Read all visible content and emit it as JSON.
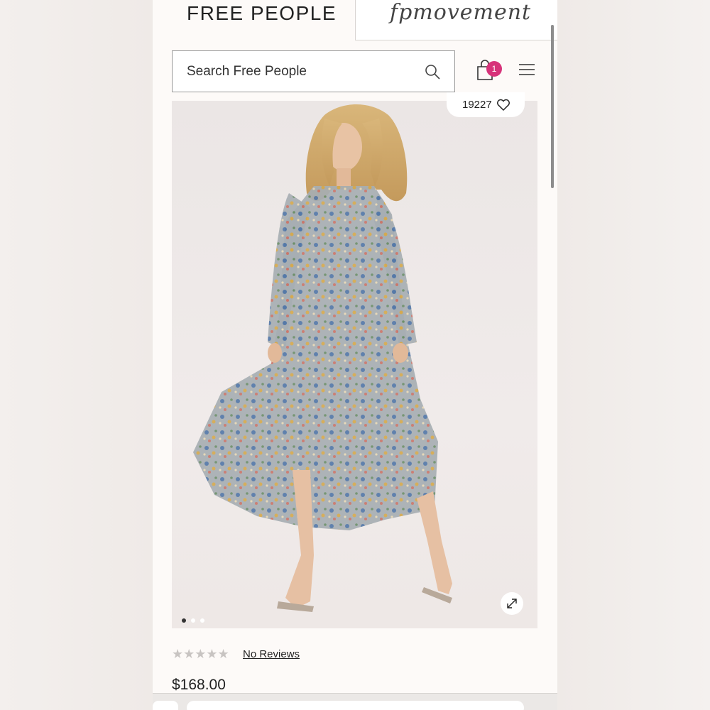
{
  "header": {
    "brand": "FREE PEOPLE",
    "secondary_brand": "fpmovement"
  },
  "search": {
    "placeholder": "Search Free People"
  },
  "cart": {
    "count": "1",
    "badge_color": "#d7337a"
  },
  "product": {
    "favorites_count": "19227",
    "image_count": 3,
    "active_image_index": 0,
    "rating_stars": "★★★★★",
    "rating_value": 0,
    "reviews_label": "No Reviews",
    "price": "$168.00"
  },
  "icons": {
    "search": "search-icon",
    "bag": "shopping-bag-icon",
    "menu": "hamburger-menu-icon",
    "favorite": "heart-icon",
    "expand": "expand-icon"
  }
}
